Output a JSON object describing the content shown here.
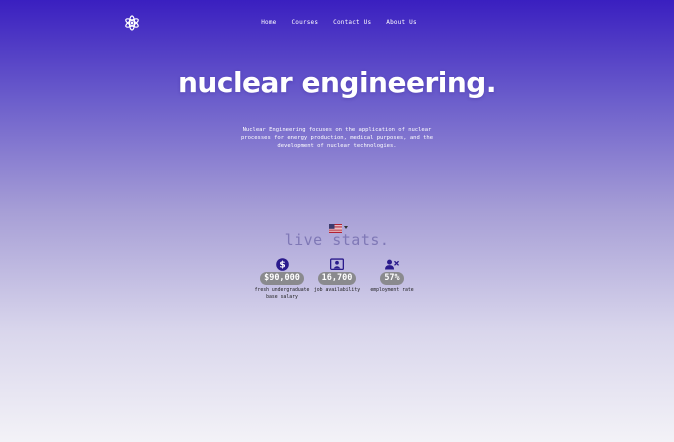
{
  "nav": {
    "logo_icon": "atom-icon",
    "items": [
      "Home",
      "Courses",
      "Contact Us",
      "About Us"
    ]
  },
  "hero": {
    "title": "nuclear engineering.",
    "description": "Nuclear Engineering focuses on the application of nuclear processes for energy production, medical purposes, and the development of nuclear technologies."
  },
  "stats": {
    "locale_icon": "us-flag-icon",
    "title": "live stats.",
    "items": [
      {
        "icon": "dollar-circle-icon",
        "value": "$90,000",
        "label": "fresh undergraduate base salary"
      },
      {
        "icon": "job-board-icon",
        "value": "16,700",
        "label": "job availability"
      },
      {
        "icon": "user-times-icon",
        "value": "57%",
        "label": "employment rate"
      }
    ]
  },
  "colors": {
    "primary": "#3a1fc0",
    "icon": "#2a1a8c",
    "badge": "#8a8a8e",
    "stats_title": "#7f78b6"
  }
}
